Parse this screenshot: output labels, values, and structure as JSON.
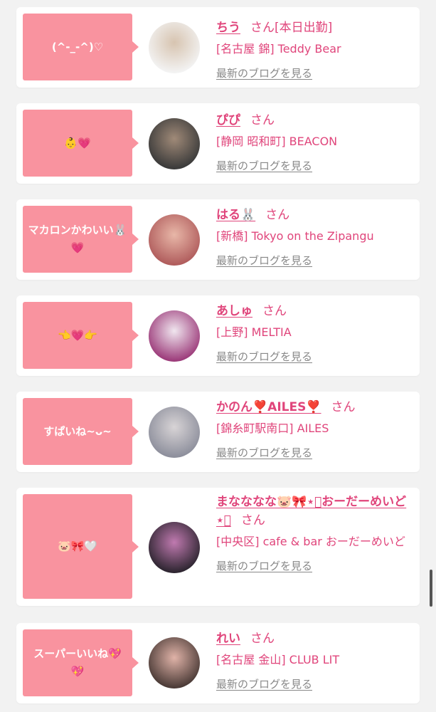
{
  "entries": [
    {
      "bubble": "(^-_-^)♡",
      "name": "ちう",
      "honorific": "さん",
      "status": "[本日出勤]",
      "area": "[名古屋 錦] Teddy Bear",
      "blog_link": "最新のブログを見る",
      "avatar_colors": [
        "#f3f3f3",
        "#d7c4b0"
      ]
    },
    {
      "bubble": "👶💗",
      "name": "ぴぴ",
      "honorific": "さん",
      "status": "",
      "area": "[静岡 昭和町] BEACON",
      "blog_link": "最新のブログを見る",
      "avatar_colors": [
        "#3a3a3a",
        "#a08a78"
      ]
    },
    {
      "bubble": "マカロンかわいい🐰💗",
      "name": "はる🐰",
      "honorific": "さん",
      "status": "",
      "area": "[新橋] Tokyo on the Zipangu",
      "blog_link": "最新のブログを見る",
      "avatar_colors": [
        "#b05c5c",
        "#e8b7a8"
      ]
    },
    {
      "bubble": "👈💗👉",
      "name": "あしゅ",
      "honorific": "さん",
      "status": "",
      "area": "[上野] MELTIA",
      "blog_link": "最新のブログを見る",
      "avatar_colors": [
        "#9c3b7a",
        "#f0e6ef"
      ]
    },
    {
      "bubble": "すぱいね~ᴗ~",
      "name": "かのん❣️AILES❣️",
      "honorific": "さん",
      "status": "",
      "area": "[錦糸町駅南口] AILES",
      "blog_link": "最新のブログを見る",
      "avatar_colors": [
        "#8d8f9c",
        "#d8d4d6"
      ]
    },
    {
      "bubble": "🐷🎀🤍",
      "name": "まなななな🐷🎀⋆͛おーだーめいど⋆͛",
      "honorific": "さん",
      "status": "",
      "area": "[中央区] cafe & bar おーだーめいど",
      "blog_link": "最新のブログを見る",
      "avatar_colors": [
        "#2d2530",
        "#c07ab0"
      ]
    },
    {
      "bubble": "スーパーいいね💖💖",
      "name": "れい",
      "honorific": "さん",
      "status": "",
      "area": "[名古屋 金山] CLUB LIT",
      "blog_link": "最新のブログを見る",
      "avatar_colors": [
        "#4a3a36",
        "#e0b3a8"
      ]
    }
  ],
  "colors": {
    "bubble": "#f9939f",
    "accent": "#e0457b",
    "link_gray": "#888888",
    "background": "#f2f2f2"
  }
}
